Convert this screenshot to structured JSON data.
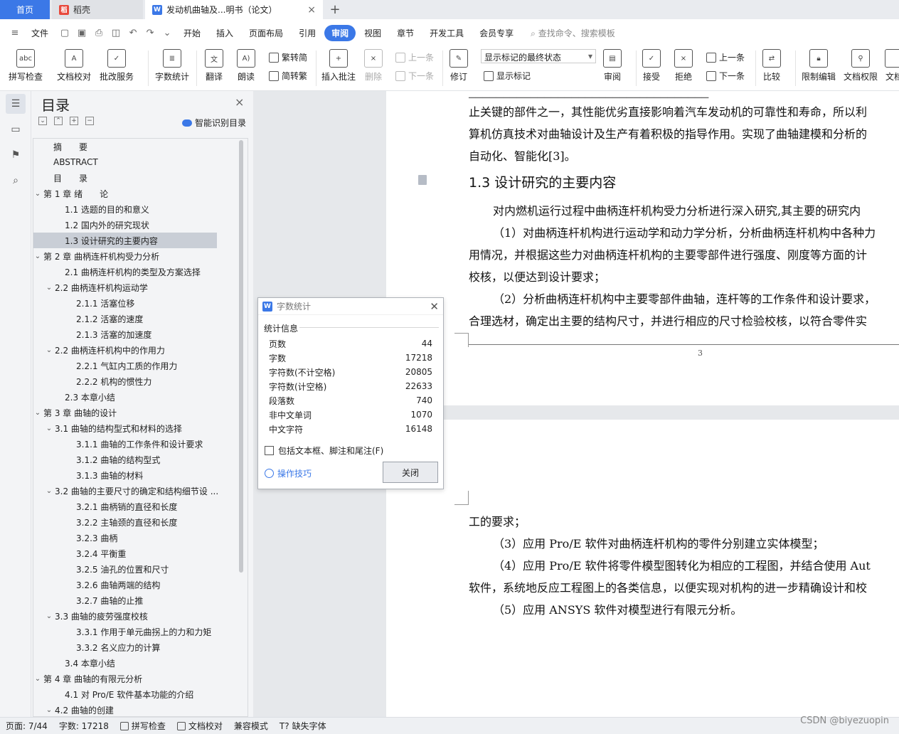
{
  "tabs": {
    "home": "首页",
    "daoke": "稻壳",
    "active_doc": "发动机曲轴及...明书（论文）"
  },
  "menu": {
    "file": "文件",
    "items": [
      "开始",
      "插入",
      "页面布局",
      "引用",
      "审阅",
      "视图",
      "章节",
      "开发工具",
      "会员专享"
    ],
    "search": "查找命令、搜索模板"
  },
  "ribbon": {
    "spell": "拼写检查",
    "proof": "文档校对",
    "annotate_service": "批改服务",
    "word_count": "字数统计",
    "translate": "翻译",
    "read_aloud": "朗读",
    "trad_conv": "繁转简",
    "simp_conv": "简转繁",
    "insert_comment": "插入批注",
    "delete": "删除",
    "prev_comment": "上一条",
    "next_comment": "下一条",
    "revise": "修订",
    "markup_select": "显示标记的最终状态",
    "show_markup": "显示标记",
    "review": "审阅",
    "accept": "接受",
    "reject": "拒绝",
    "prev": "上一条",
    "next": "下一条",
    "compare": "比较",
    "restrict": "限制编辑",
    "permission": "文档权限",
    "doc_more": "文档"
  },
  "toc": {
    "title": "目录",
    "smart": "智能识别目录",
    "items": [
      {
        "text": "摘　　要",
        "level": 1,
        "arrow": ""
      },
      {
        "text": "ABSTRACT",
        "level": 1,
        "arrow": ""
      },
      {
        "text": "目　　录",
        "level": 1,
        "arrow": ""
      },
      {
        "text": "第 1 章  绪　　论",
        "level": 1,
        "arrow": "v"
      },
      {
        "text": "1.1  选题的目的和意义",
        "level": 2,
        "arrow": ""
      },
      {
        "text": "1.2  国内外的研究现状",
        "level": 2,
        "arrow": ""
      },
      {
        "text": "1.3  设计研究的主要内容",
        "level": 2,
        "arrow": "",
        "selected": true
      },
      {
        "text": "第 2 章  曲柄连杆机构受力分析",
        "level": 1,
        "arrow": "v"
      },
      {
        "text": "2.1  曲柄连杆机构的类型及方案选择",
        "level": 2,
        "arrow": ""
      },
      {
        "text": "2.2  曲柄连杆机构运动学",
        "level": 2,
        "arrow": "v"
      },
      {
        "text": "2.1.1  活塞位移",
        "level": 3,
        "arrow": ""
      },
      {
        "text": "2.1.2  活塞的速度",
        "level": 3,
        "arrow": ""
      },
      {
        "text": "2.1.3  活塞的加速度",
        "level": 3,
        "arrow": ""
      },
      {
        "text": "2.2  曲柄连杆机构中的作用力",
        "level": 2,
        "arrow": "v"
      },
      {
        "text": "2.2.1  气缸内工质的作用力",
        "level": 3,
        "arrow": ""
      },
      {
        "text": "2.2.2  机构的惯性力",
        "level": 3,
        "arrow": ""
      },
      {
        "text": "2.3  本章小结",
        "level": 2,
        "arrow": ""
      },
      {
        "text": "第 3 章  曲轴的设计",
        "level": 1,
        "arrow": "v"
      },
      {
        "text": "3.1  曲轴的结构型式和材料的选择",
        "level": 2,
        "arrow": "v"
      },
      {
        "text": "3.1.1  曲轴的工作条件和设计要求",
        "level": 3,
        "arrow": ""
      },
      {
        "text": "3.1.2  曲轴的结构型式",
        "level": 3,
        "arrow": ""
      },
      {
        "text": "3.1.3  曲轴的材料",
        "level": 3,
        "arrow": ""
      },
      {
        "text": "3.2  曲轴的主要尺寸的确定和结构细节设 ...",
        "level": 2,
        "arrow": "v"
      },
      {
        "text": "3.2.1  曲柄销的直径和长度",
        "level": 3,
        "arrow": ""
      },
      {
        "text": "3.2.2  主轴颈的直径和长度",
        "level": 3,
        "arrow": ""
      },
      {
        "text": "3.2.3  曲柄",
        "level": 3,
        "arrow": ""
      },
      {
        "text": "3.2.4  平衡重",
        "level": 3,
        "arrow": ""
      },
      {
        "text": "3.2.5  油孔的位置和尺寸",
        "level": 3,
        "arrow": ""
      },
      {
        "text": "3.2.6  曲轴两端的结构",
        "level": 3,
        "arrow": ""
      },
      {
        "text": "3.2.7  曲轴的止推",
        "level": 3,
        "arrow": ""
      },
      {
        "text": "3.3  曲轴的疲劳强度校核",
        "level": 2,
        "arrow": "v"
      },
      {
        "text": "3.3.1  作用于单元曲拐上的力和力矩",
        "level": 3,
        "arrow": ""
      },
      {
        "text": "3.3.2  名义应力的计算",
        "level": 3,
        "arrow": ""
      },
      {
        "text": "3.4  本章小结",
        "level": 2,
        "arrow": ""
      },
      {
        "text": "第 4 章  曲轴的有限元分析",
        "level": 1,
        "arrow": "v"
      },
      {
        "text": "4.1  对 Pro/E 软件基本功能的介绍",
        "level": 2,
        "arrow": ""
      },
      {
        "text": "4.2  曲轴的创建",
        "level": 2,
        "arrow": "v"
      }
    ]
  },
  "document": {
    "page1_lines": [
      "止关键的部件之一，其性能优劣直接影响着汽车发动机的可靠性和寿命，所以利",
      "算机仿真技术对曲轴设计及生产有着积极的指导作用。实现了曲轴建模和分析的",
      "自动化、智能化[3]。"
    ],
    "heading": "1.3  设计研究的主要内容",
    "page1_body": [
      "对内燃机运行过程中曲柄连杆机构受力分析进行深入研究,其主要的研究内",
      "（1）对曲柄连杆机构进行运动学和动力学分析，分析曲柄连杆机构中各种力",
      "用情况，并根据这些力对曲柄连杆机构的主要零部件进行强度、刚度等方面的计",
      "校核，以便达到设计要求；",
      "（2）分析曲柄连杆机构中主要零部件曲轴，连杆等的工作条件和设计要求，",
      "合理选材，确定出主要的结构尺寸，并进行相应的尺寸检验校核，以符合零件实"
    ],
    "page_number": "3",
    "page2_body": [
      "工的要求；",
      "（3）应用 Pro/E 软件对曲柄连杆机构的零件分别建立实体模型；",
      "（4）应用 Pro/E 软件将零件模型图转化为相应的工程图，并结合使用 Aut",
      "软件，系统地反应工程图上的各类信息，以便实现对机构的进一步精确设计和校",
      "（5）应用 ANSYS 软件对模型进行有限元分析。"
    ]
  },
  "dialog": {
    "title": "字数统计",
    "section": "统计信息",
    "rows": [
      {
        "label": "页数",
        "value": "44"
      },
      {
        "label": "字数",
        "value": "17218"
      },
      {
        "label": "字符数(不计空格)",
        "value": "20805"
      },
      {
        "label": "字符数(计空格)",
        "value": "22633"
      },
      {
        "label": "段落数",
        "value": "740"
      },
      {
        "label": "非中文单词",
        "value": "1070"
      },
      {
        "label": "中文字符",
        "value": "16148"
      }
    ],
    "checkbox": "包括文本框、脚注和尾注(F)",
    "tips": "操作技巧",
    "close": "关闭"
  },
  "status": {
    "page": "页面: 7/44",
    "words": "字数: 17218",
    "spell": "拼写检查",
    "proof": "文档校对",
    "compat": "兼容模式",
    "missing_font": "缺失字体"
  },
  "watermark": "CSDN @biyezuopin",
  "colors": {
    "accent": "#3b78e7",
    "daoke": "#e8483b"
  }
}
